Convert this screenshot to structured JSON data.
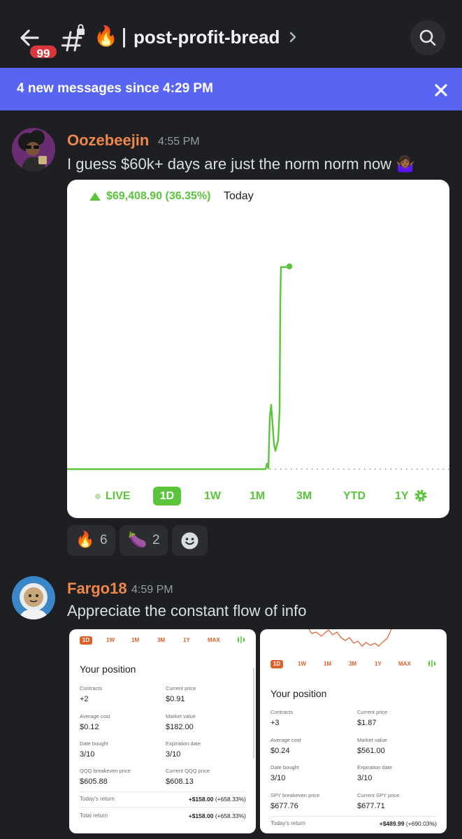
{
  "header": {
    "unread_count": "99",
    "channel_emoji": "🔥",
    "channel_name": "post-profit-bread"
  },
  "banner": {
    "text": "4 new messages since 4:29 PM"
  },
  "messages": [
    {
      "username": "Oozebeejin",
      "timestamp": "4:55 PM",
      "text": "I guess $60k+ days are just the norm norm now 🤷🏾‍♀️",
      "chart": {
        "gain": "$69,408.90 (36.35%)",
        "period_label": "Today",
        "ranges": [
          "LIVE",
          "1D",
          "1W",
          "1M",
          "3M",
          "YTD",
          "1Y"
        ],
        "active_range": "1D",
        "accent": "#5ac53b"
      },
      "reactions": [
        {
          "emoji": "🔥",
          "count": "6"
        },
        {
          "emoji": "🍆",
          "count": "2"
        }
      ]
    },
    {
      "username": "Fargo18",
      "timestamp": "4:59 PM",
      "text": "Appreciate the constant flow of info",
      "cards": [
        {
          "tabs": [
            "1D",
            "1W",
            "1M",
            "3M",
            "1Y",
            "MAX"
          ],
          "title": "Your position",
          "fields": [
            {
              "label": "Contracts",
              "value": "+2"
            },
            {
              "label": "Current price",
              "value": "$0.91"
            },
            {
              "label": "Average cost",
              "value": "$0.12"
            },
            {
              "label": "Market value",
              "value": "$182.00"
            },
            {
              "label": "Date bought",
              "value": "3/10"
            },
            {
              "label": "Expiration date",
              "value": "3/10"
            },
            {
              "label": "QQQ breakeven price",
              "value": "$605.88"
            },
            {
              "label": "Current QQQ price",
              "value": "$608.13"
            }
          ],
          "returns": [
            {
              "label": "Today's return",
              "amount": "+$158.00",
              "pct": "(+658.33%)"
            },
            {
              "label": "Total return",
              "amount": "+$158.00",
              "pct": "(+658.33%)"
            }
          ]
        },
        {
          "tabs": [
            "1D",
            "1W",
            "1M",
            "3M",
            "1Y",
            "MAX"
          ],
          "title": "Your position",
          "fields": [
            {
              "label": "Contracts",
              "value": "+3"
            },
            {
              "label": "Current price",
              "value": "$1.87"
            },
            {
              "label": "Average cost",
              "value": "$0.24"
            },
            {
              "label": "Market value",
              "value": "$561.00"
            },
            {
              "label": "Date bought",
              "value": "3/10"
            },
            {
              "label": "Expiration date",
              "value": "3/10"
            },
            {
              "label": "SPY breakeven price",
              "value": "$677.76"
            },
            {
              "label": "Current SPY price",
              "value": "$677.71"
            }
          ],
          "returns": [
            {
              "label": "Today's return",
              "amount": "+$489.99",
              "pct": "(+690.03%)"
            }
          ]
        }
      ]
    }
  ],
  "icons": {
    "back": "arrow-left-icon",
    "channel": "locked-hash-icon",
    "search": "search-icon",
    "close": "close-icon",
    "add_reaction": "smiley-icon",
    "settings": "gear-icon",
    "chart_type": "candlestick-icon"
  }
}
